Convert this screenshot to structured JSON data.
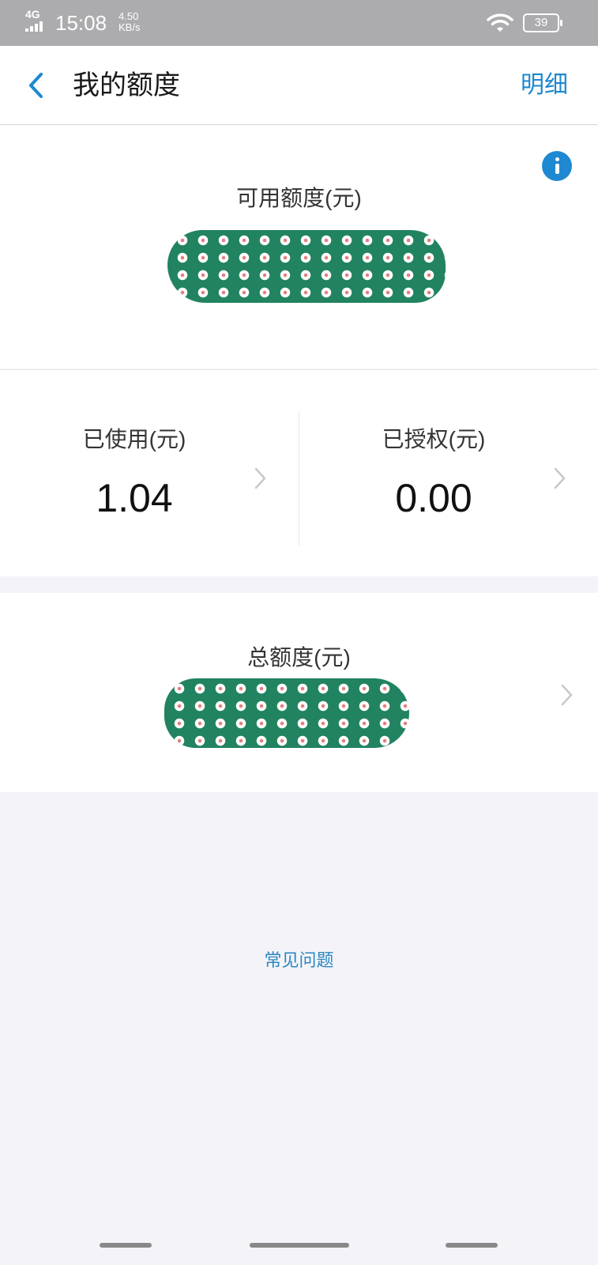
{
  "status_bar": {
    "network": "4G",
    "time": "15:08",
    "speed_value": "4.50",
    "speed_unit": "KB/s",
    "battery": "39"
  },
  "header": {
    "title": "我的额度",
    "detail_label": "明细",
    "back_icon": "chevron-left-icon"
  },
  "available": {
    "label": "可用额度(元)",
    "info_icon": "info-icon"
  },
  "used": {
    "label": "已使用(元)",
    "value": "1.04"
  },
  "authorized": {
    "label": "已授权(元)",
    "value": "0.00"
  },
  "total": {
    "label": "总额度(元)"
  },
  "faq_label": "常见问题",
  "colors": {
    "accent": "#1e88d0",
    "link": "#2a86c2",
    "redaction": "#21835f",
    "status_bar": "#acacae",
    "page_bg": "#f4f4f8"
  }
}
